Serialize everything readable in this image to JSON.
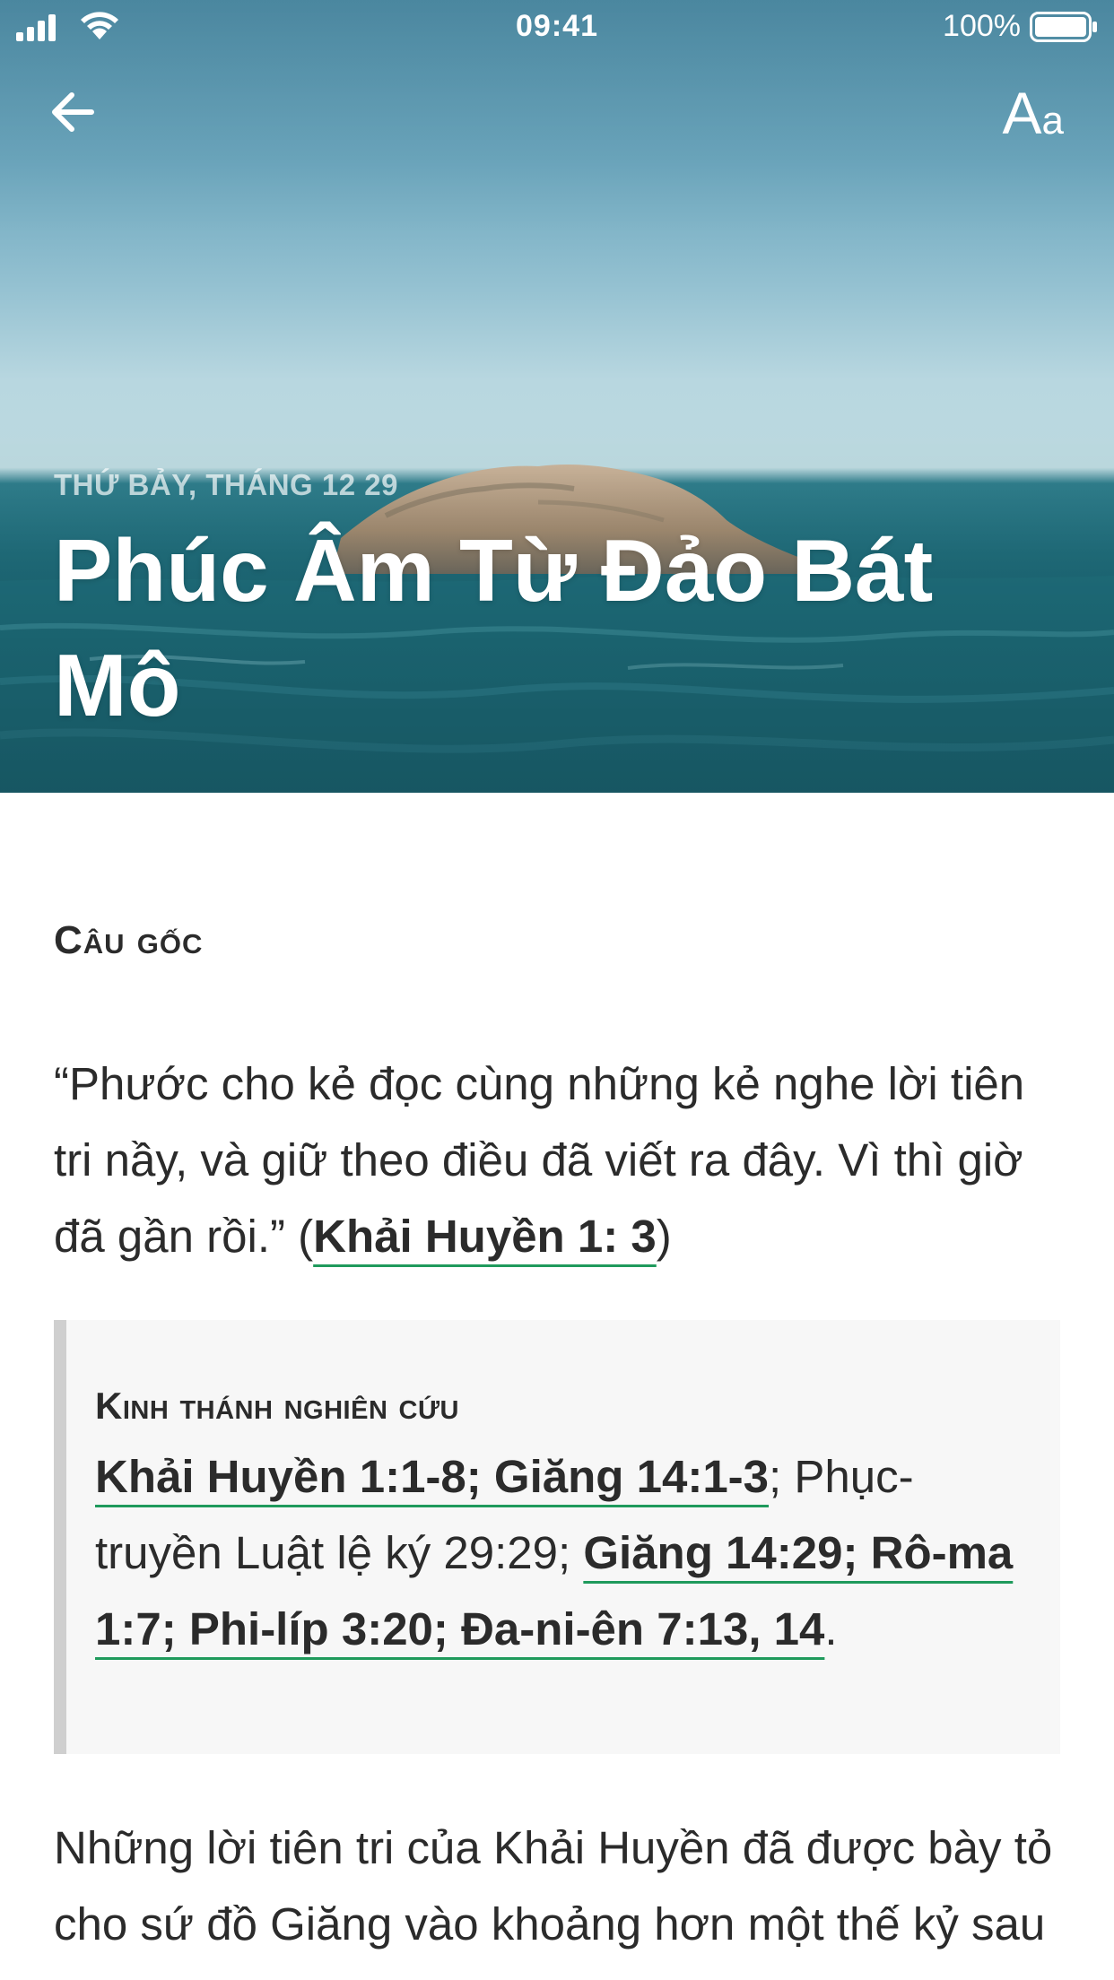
{
  "status_bar": {
    "time": "09:41",
    "battery": "100%",
    "signal_icon": "signal-bars-icon",
    "wifi_icon": "wifi-icon",
    "battery_icon": "battery-full-icon"
  },
  "nav": {
    "back_icon": "arrow-left-icon",
    "font_big": "A",
    "font_small": "a"
  },
  "hero": {
    "date": "THỨ BẢY, THÁNG 12 29",
    "title": "Phúc Âm Từ Đảo Bát Mô"
  },
  "memory_verse": {
    "heading": "Câu gốc",
    "text": "“Phước cho kẻ đọc cùng những kẻ nghe lời tiên tri nầy, và giữ theo điều đã viết ra đây. Vì thì giờ đã gần rồi.” (",
    "reference": "Khải Huyền 1: 3",
    "closing": ")"
  },
  "study": {
    "heading": "Kinh thánh nghiên cứu",
    "ref1": "Khải Huyền 1:1-8; Giăng 14:1-3",
    "sep1": "; Phục-truyền Luật lệ ký 29:29; ",
    "ref2": "Giăng 14:29; Rô-ma 1:7; Phi-líp 3:20; Đa-ni-ên 7:13, 14",
    "end": "."
  },
  "body": {
    "paragraph": "Những lời tiên tri của Khải Huyền đã được bày tỏ cho sứ đồ Giăng vào khoảng hơn một thế kỷ sau khi Chúa Giê-xu hiện"
  },
  "colors": {
    "link_underline": "#1f9a5c",
    "study_border": "#cfcfcf",
    "study_bg": "#f7f7f7"
  }
}
